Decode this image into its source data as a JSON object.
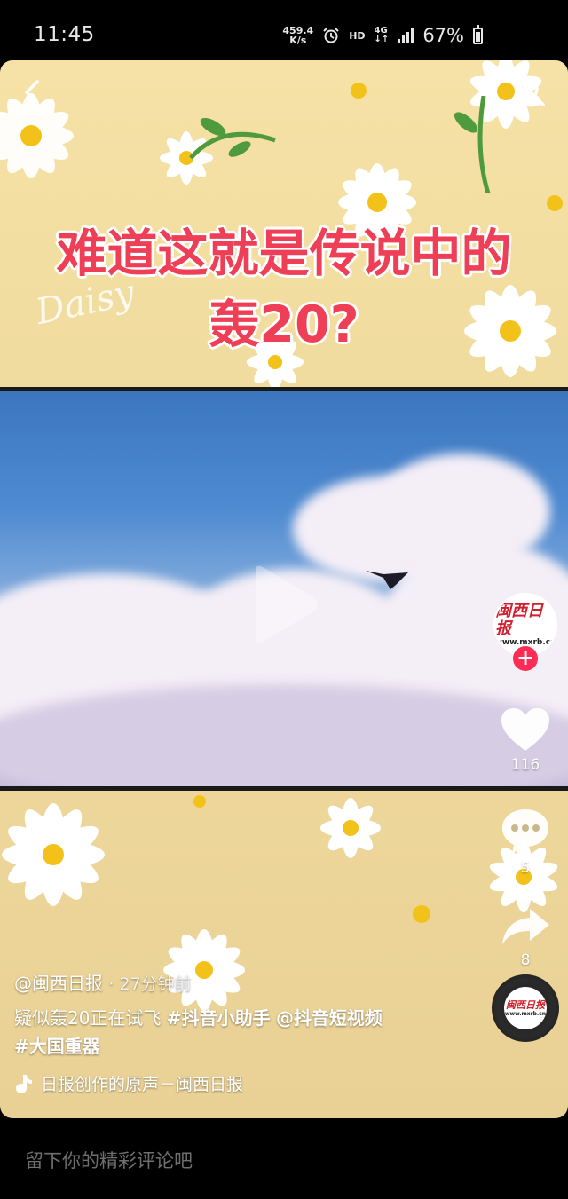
{
  "status_bar": {
    "time": "11:45",
    "net_speed_value": "459.4",
    "net_speed_unit": "K/s",
    "hd": "HD",
    "network": "4G",
    "battery": "67%"
  },
  "video": {
    "title_line1": "难道这就是传说中的",
    "title_line2": "轰20?",
    "watermark_text": "Daisy"
  },
  "creator": {
    "avatar_title": "闽西日报",
    "avatar_url": "www.mxrb.cn",
    "follow_symbol": "+"
  },
  "actions": {
    "likes": "116",
    "comments": "5",
    "shares": "8"
  },
  "post": {
    "author": "@闽西日报",
    "time": "· 27分钟前",
    "caption_text": "疑似轰20正在试飞",
    "tags": [
      "#抖音小助手",
      "@抖音短视频",
      "#大国重器"
    ],
    "music": "日报创作的原声－闽西日报"
  },
  "comment_bar": {
    "placeholder": "留下你的精彩评论吧"
  },
  "colors": {
    "accent": "#fe2c55",
    "title_red": "#ee3f57",
    "background": "#000000"
  }
}
